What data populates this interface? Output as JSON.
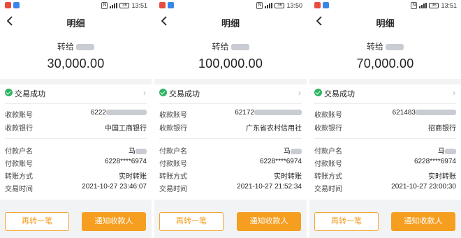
{
  "colors": {
    "accent": "#f59e20",
    "success": "#2fb563",
    "page_bg": "#f2f3f5"
  },
  "icons": {
    "back": "chevron-left-icon",
    "success": "check-circle-icon",
    "more": "chevron-right-icon"
  },
  "panels": [
    {
      "status_bar": {
        "time": "13:51",
        "battery": "36"
      },
      "nav": {
        "title": "明细"
      },
      "hero": {
        "to_label": "转给",
        "amount": "30,000.00"
      },
      "status": {
        "label": "交易成功"
      },
      "account": {
        "label": "收款账号",
        "value": "6222"
      },
      "bank": {
        "label": "收款银行",
        "value": "中国工商银行"
      },
      "payer_name": {
        "label": "付款户名",
        "value": "马"
      },
      "payer_account": {
        "label": "付款账号",
        "value": "6228****6974"
      },
      "method": {
        "label": "转账方式",
        "value": "实时转账"
      },
      "time": {
        "label": "交易时间",
        "value": "2021-10-27 23:46:07"
      },
      "buttons": {
        "again": "再转一笔",
        "notify": "通知收款人"
      }
    },
    {
      "status_bar": {
        "time": "13:50",
        "battery": "36"
      },
      "nav": {
        "title": "明细"
      },
      "hero": {
        "to_label": "转给",
        "amount": "100,000.00"
      },
      "status": {
        "label": "交易成功"
      },
      "account": {
        "label": "收款账号",
        "value": "62172"
      },
      "bank": {
        "label": "收款银行",
        "value": "广东省农村信用社"
      },
      "payer_name": {
        "label": "付款户名",
        "value": "马"
      },
      "payer_account": {
        "label": "付款账号",
        "value": "6228****6974"
      },
      "method": {
        "label": "转账方式",
        "value": "实时转账"
      },
      "time": {
        "label": "交易时间",
        "value": "2021-10-27 21:52:34"
      },
      "buttons": {
        "again": "再转一笔",
        "notify": "通知收款人"
      }
    },
    {
      "status_bar": {
        "time": "13:51",
        "battery": "36"
      },
      "nav": {
        "title": "明细"
      },
      "hero": {
        "to_label": "转给",
        "amount": "70,000.00"
      },
      "status": {
        "label": "交易成功"
      },
      "account": {
        "label": "收款账号",
        "value": "621483"
      },
      "bank": {
        "label": "收款银行",
        "value": "招商银行"
      },
      "payer_name": {
        "label": "付款户名",
        "value": "马"
      },
      "payer_account": {
        "label": "付款账号",
        "value": "6228****6974"
      },
      "method": {
        "label": "转账方式",
        "value": "实时转账"
      },
      "time": {
        "label": "交易时间",
        "value": "2021-10-27 23:00:30"
      },
      "buttons": {
        "again": "再转一笔",
        "notify": "通知收款人"
      }
    }
  ]
}
